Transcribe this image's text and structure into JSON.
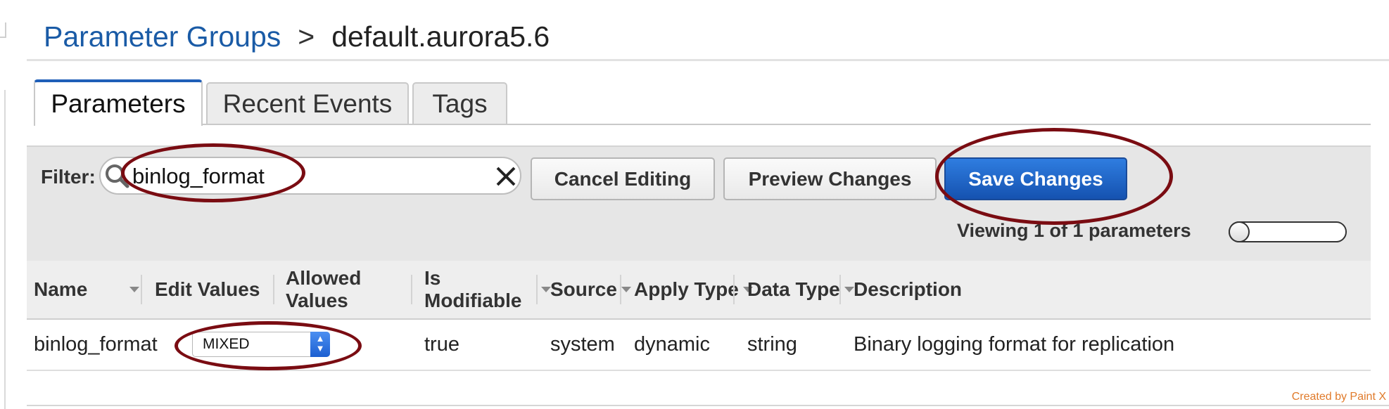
{
  "breadcrumb": {
    "parent": "Parameter Groups",
    "separator": ">",
    "current": "default.aurora5.6"
  },
  "tabs": [
    {
      "label": "Parameters",
      "active": true
    },
    {
      "label": "Recent Events"
    },
    {
      "label": "Tags"
    }
  ],
  "filter": {
    "label": "Filter:",
    "value": "binlog_format"
  },
  "buttons": {
    "cancel": "Cancel Editing",
    "preview": "Preview Changes",
    "save": "Save Changes"
  },
  "viewing": "Viewing 1 of 1 parameters",
  "columns": [
    "Name",
    "Edit Values",
    "Allowed Values",
    "Is Modifiable",
    "Source",
    "Apply Type",
    "Data Type",
    "Description"
  ],
  "rows": [
    {
      "name": "binlog_format",
      "edit_value": "MIXED",
      "allowed_values": "",
      "is_modifiable": "true",
      "source": "system",
      "apply_type": "dynamic",
      "data_type": "string",
      "description": "Binary logging format for replication"
    }
  ],
  "credit": "Created by Paint X",
  "colors": {
    "link": "#1a5ba6",
    "primary_button": "#1f5fb8",
    "annotation": "#7a0c12"
  }
}
